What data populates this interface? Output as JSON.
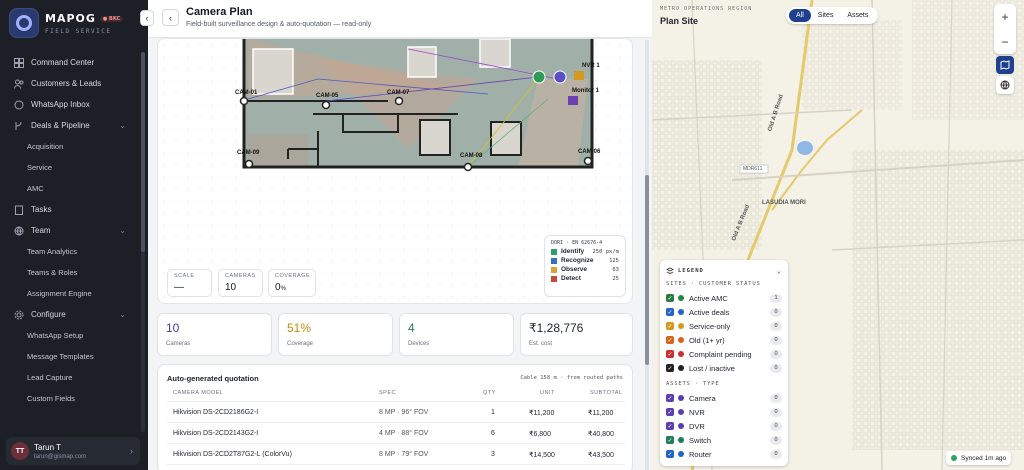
{
  "brand": {
    "name": "MAPOG",
    "tag": "● BKC",
    "sub": "FIELD SERVICE"
  },
  "nav": {
    "command_center": "Command Center",
    "customers": "Customers & Leads",
    "whatsapp": "WhatsApp Inbox",
    "deals": "Deals & Pipeline",
    "acquisition": "Acquisition",
    "service": "Service",
    "amc": "AMC",
    "tasks": "Tasks",
    "team": "Team",
    "team_analytics": "Team Analytics",
    "teams_roles": "Teams & Roles",
    "assignment": "Assignment Engine",
    "configure": "Configure",
    "whatsapp_setup": "WhatsApp Setup",
    "message_templates": "Message Templates",
    "lead_capture": "Lead Capture",
    "custom_fields": "Custom Fields"
  },
  "user": {
    "initials": "TT",
    "name": "Tarun T",
    "email": "tarun@gismap.com"
  },
  "header": {
    "title": "Camera Plan",
    "subtitle": "Field-built surveillance design & auto-quotation — read-only"
  },
  "plan": {
    "cameras": [
      "CAM-01",
      "CAM-05",
      "CAM-07",
      "CAM-09",
      "CAM-08",
      "CAM-06"
    ],
    "nvr": "NVR 1",
    "monitor": "Monitor 1"
  },
  "stats": {
    "scale_label": "SCALE",
    "scale_val": "—",
    "cameras_label": "CAMERAS",
    "cameras_val": "10",
    "coverage_label": "COVERAGE",
    "coverage_val": "0",
    "coverage_unit": "%"
  },
  "dori": {
    "title": "DORI · EN 62676-4",
    "rows": [
      {
        "label": "Identify",
        "value": "250 px/m",
        "color": "#2f9e6b"
      },
      {
        "label": "Recognize",
        "value": "125",
        "color": "#3b6fb6"
      },
      {
        "label": "Observe",
        "value": "63",
        "color": "#d9a23b"
      },
      {
        "label": "Detect",
        "value": "25",
        "color": "#c24b3a"
      }
    ]
  },
  "metrics": {
    "cameras": {
      "value": "10",
      "label": "Cameras",
      "color": "#3d3fa8"
    },
    "coverage": {
      "value": "51%",
      "label": "Coverage",
      "color": "#c98a0b"
    },
    "devices": {
      "value": "4",
      "label": "Devices",
      "color": "#1f7d5a"
    },
    "cost": {
      "value": "₹1,28,776",
      "label": "Est. cost",
      "color": "#1f2430"
    }
  },
  "quote": {
    "title": "Auto-generated quotation",
    "note": "Cable 158 m · from routed paths",
    "headers": [
      "CAMERA MODEL",
      "SPEC",
      "QTY",
      "UNIT",
      "SUBTOTAL"
    ],
    "rows": [
      {
        "model": "Hikvision DS-2CD2186G2-I",
        "spec": "8 MP · 96° FOV",
        "qty": "1",
        "unit": "₹11,200",
        "subtotal": "₹11,200"
      },
      {
        "model": "Hikvision DS-2CD2143G2-I",
        "spec": "4 MP · 88° FOV",
        "qty": "6",
        "unit": "₹6,800",
        "subtotal": "₹40,800"
      },
      {
        "model": "Hikvision DS-2CD2T87G2-L (ColorVu)",
        "spec": "8 MP · 79° FOV",
        "qty": "3",
        "unit": "₹14,500",
        "subtotal": "₹43,500"
      }
    ]
  },
  "map": {
    "region": "METRO OPERATIONS REGION",
    "title": "Plan Site",
    "filters": [
      "All",
      "Sites",
      "Assets"
    ],
    "labels": {
      "road1": "Old A B Road",
      "road2": "Old A B Road",
      "mdr": "MDR611",
      "area": "LASUDIA MORI"
    },
    "legend": {
      "title": "LEGEND",
      "sites_title": "SITES · CUSTOMER STATUS",
      "sites": [
        {
          "label": "Active AMC",
          "count": "1",
          "color": "#1f8a3e"
        },
        {
          "label": "Active deals",
          "count": "0",
          "color": "#2563c9"
        },
        {
          "label": "Service-only",
          "count": "0",
          "color": "#d49a1e"
        },
        {
          "label": "Old (1+ yr)",
          "count": "0",
          "color": "#d4661e"
        },
        {
          "label": "Complaint pending",
          "count": "0",
          "color": "#c93030"
        },
        {
          "label": "Lost / inactive",
          "count": "0",
          "color": "#222222"
        }
      ],
      "assets_title": "ASSETS · TYPE",
      "assets": [
        {
          "label": "Camera",
          "count": "0",
          "color": "#5b3fb0"
        },
        {
          "label": "NVR",
          "count": "0",
          "color": "#5b3fb0"
        },
        {
          "label": "DVR",
          "count": "0",
          "color": "#5b3fb0"
        },
        {
          "label": "Switch",
          "count": "0",
          "color": "#1f7d5a"
        },
        {
          "label": "Router",
          "count": "0",
          "color": "#2563c9"
        }
      ]
    },
    "synced": "Synced 1m ago"
  }
}
